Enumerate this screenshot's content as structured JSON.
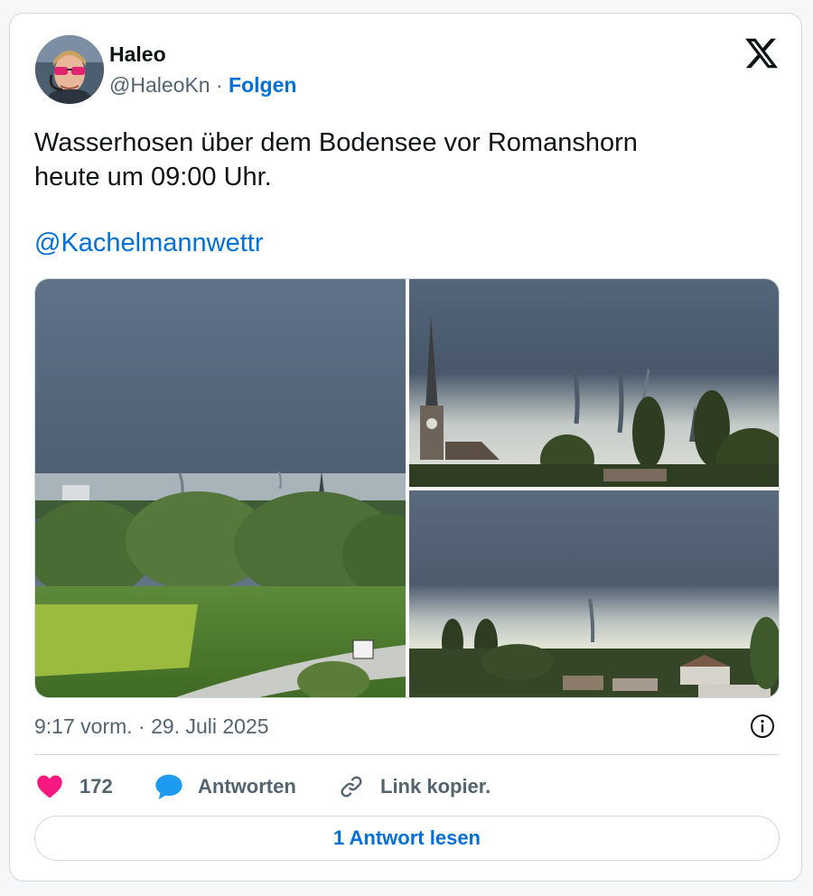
{
  "author": {
    "name": "Haleo",
    "handle": "@HaleoKn",
    "separator": "·",
    "follow_label": "Folgen"
  },
  "brand": {
    "logo": "x-logo-icon"
  },
  "tweet": {
    "line1": "Wasserhosen über dem Bodensee vor Romanshorn",
    "line2": "heute um 09:00 Uhr.",
    "mention": "@Kachelmannwettr"
  },
  "media": {
    "photo_count": 3
  },
  "meta": {
    "timestamp": "9:17 vorm. · 29. Juli 2025"
  },
  "actions": {
    "like_count": "172",
    "reply_label": "Antworten",
    "copy_label": "Link kopier."
  },
  "footer": {
    "read_replies_label": "1 Antwort lesen"
  },
  "colors": {
    "link": "#006fd6",
    "like": "#f91880",
    "reply": "#1d9bf0",
    "text": "#0f1419",
    "muted": "#536471",
    "border": "#cfd9de"
  }
}
